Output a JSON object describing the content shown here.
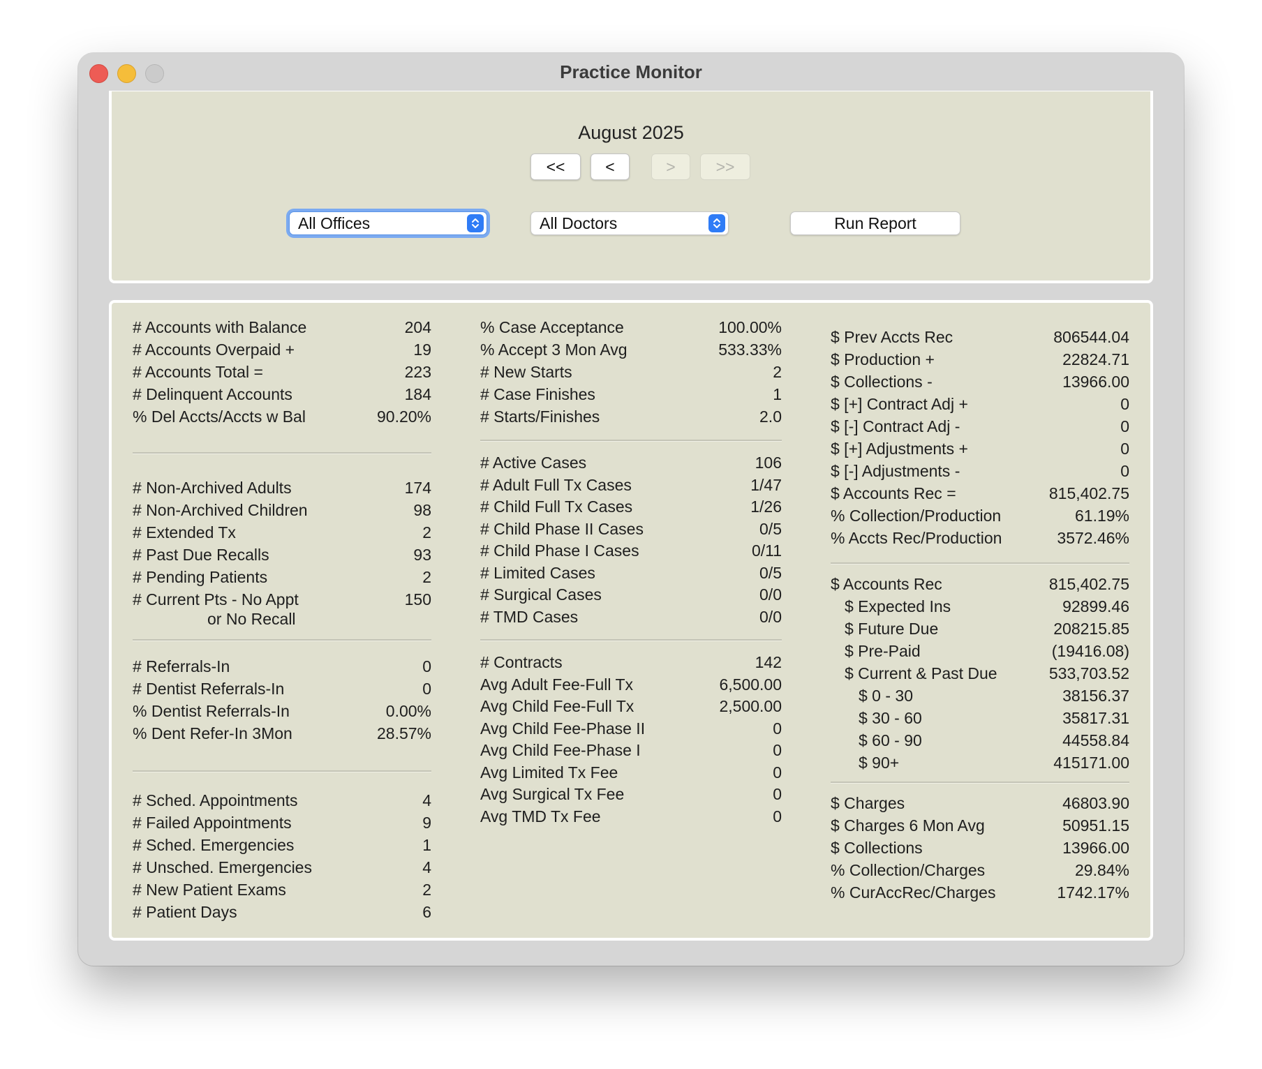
{
  "window": {
    "title": "Practice Monitor"
  },
  "period": "August 2025",
  "nav": {
    "first": "<<",
    "prev": "<",
    "next": ">",
    "last": ">>"
  },
  "filters": {
    "office": {
      "selected": "All Offices"
    },
    "doctor": {
      "selected": "All Doctors"
    },
    "run_label": "Run Report"
  },
  "col1": {
    "accounts": [
      {
        "label": "# Accounts with Balance",
        "value": "204"
      },
      {
        "label": "# Accounts Overpaid +",
        "value": "19"
      },
      {
        "label": "# Accounts Total =",
        "value": "223"
      },
      {
        "label": "# Delinquent Accounts",
        "value": "184"
      },
      {
        "label": "% Del Accts/Accts w Bal",
        "value": "90.20%"
      }
    ],
    "patients": [
      {
        "label": "# Non-Archived Adults",
        "value": "174"
      },
      {
        "label": "# Non-Archived Children",
        "value": "98"
      },
      {
        "label": "# Extended Tx",
        "value": "2"
      },
      {
        "label": "# Past Due Recalls",
        "value": "93"
      },
      {
        "label": "# Pending Patients",
        "value": "2"
      },
      {
        "label": "# Current Pts - No Appt",
        "label2": "or No Recall",
        "value": "150"
      }
    ],
    "referrals": [
      {
        "label": "# Referrals-In",
        "value": "0"
      },
      {
        "label": "# Dentist Referrals-In",
        "value": "0"
      },
      {
        "label": "% Dentist Referrals-In",
        "value": "0.00%"
      },
      {
        "label": "% Dent Refer-In 3Mon",
        "value": "28.57%"
      }
    ],
    "appointments": [
      {
        "label": "# Sched. Appointments",
        "value": "4"
      },
      {
        "label": "# Failed Appointments",
        "value": "9"
      },
      {
        "label": "# Sched. Emergencies",
        "value": "1"
      },
      {
        "label": "# Unsched. Emergencies",
        "value": "4"
      },
      {
        "label": "# New Patient Exams",
        "value": "2"
      },
      {
        "label": "# Patient Days",
        "value": "6"
      }
    ]
  },
  "col2": {
    "acceptance": [
      {
        "label": "% Case Acceptance",
        "value": "100.00%"
      },
      {
        "label": "% Accept 3 Mon Avg",
        "value": "533.33%"
      },
      {
        "label": "# New Starts",
        "value": "2"
      },
      {
        "label": "# Case Finishes",
        "value": "1"
      },
      {
        "label": "# Starts/Finishes",
        "value": "2.0"
      }
    ],
    "cases": [
      {
        "label": "# Active Cases",
        "value": "106"
      },
      {
        "label": "# Adult Full Tx Cases",
        "value": "1/47"
      },
      {
        "label": "# Child Full Tx Cases",
        "value": "1/26"
      },
      {
        "label": "# Child Phase II Cases",
        "value": "0/5"
      },
      {
        "label": "# Child Phase I Cases",
        "value": "0/11"
      },
      {
        "label": "# Limited Cases",
        "value": "0/5"
      },
      {
        "label": "# Surgical Cases",
        "value": "0/0"
      },
      {
        "label": "# TMD Cases",
        "value": "0/0"
      }
    ],
    "contracts": [
      {
        "label": "# Contracts",
        "value": "142"
      },
      {
        "label": "Avg Adult Fee-Full Tx",
        "value": "6,500.00"
      },
      {
        "label": "Avg Child Fee-Full Tx",
        "value": "2,500.00"
      },
      {
        "label": "Avg Child Fee-Phase II",
        "value": "0"
      },
      {
        "label": "Avg Child Fee-Phase I",
        "value": "0"
      },
      {
        "label": "Avg Limited Tx Fee",
        "value": "0"
      },
      {
        "label": "Avg Surgical Tx Fee",
        "value": "0"
      },
      {
        "label": "Avg TMD Tx Fee",
        "value": "0"
      }
    ]
  },
  "col3": {
    "receivables": [
      {
        "label": "$ Prev Accts Rec",
        "value": "806544.04"
      },
      {
        "label": "$ Production +",
        "value": "22824.71"
      },
      {
        "label": "$ Collections -",
        "value": "13966.00"
      },
      {
        "label": "$ [+] Contract Adj +",
        "value": "0"
      },
      {
        "label": "$ [-] Contract Adj -",
        "value": "0"
      },
      {
        "label": "$ [+] Adjustments +",
        "value": "0"
      },
      {
        "label": "$ [-] Adjustments -",
        "value": "0"
      },
      {
        "label": "$ Accounts Rec =",
        "value": "815,402.75"
      },
      {
        "label": "% Collection/Production",
        "value": "61.19%"
      },
      {
        "label": "% Accts Rec/Production",
        "value": "3572.46%"
      }
    ],
    "breakdown": [
      {
        "label": "$ Accounts Rec",
        "value": "815,402.75",
        "indent": 0
      },
      {
        "label": "$ Expected Ins",
        "value": "92899.46",
        "indent": 1
      },
      {
        "label": "$ Future Due",
        "value": "208215.85",
        "indent": 1
      },
      {
        "label": "$ Pre-Paid",
        "value": "(19416.08)",
        "indent": 1
      },
      {
        "label": "$ Current & Past Due",
        "value": "533,703.52",
        "indent": 1
      },
      {
        "label": "$ 0 - 30",
        "value": "38156.37",
        "indent": 2
      },
      {
        "label": "$ 30 - 60",
        "value": "35817.31",
        "indent": 2
      },
      {
        "label": "$ 60 - 90",
        "value": "44558.84",
        "indent": 2
      },
      {
        "label": "$ 90+",
        "value": "415171.00",
        "indent": 2
      }
    ],
    "charges": [
      {
        "label": "$ Charges",
        "value": "46803.90"
      },
      {
        "label": "$ Charges 6 Mon Avg",
        "value": "50951.15"
      },
      {
        "label": "$ Collections",
        "value": "13966.00"
      },
      {
        "label": "% Collection/Charges",
        "value": "29.84%"
      },
      {
        "label": "% CurAccRec/Charges",
        "value": "1742.17%"
      }
    ]
  }
}
